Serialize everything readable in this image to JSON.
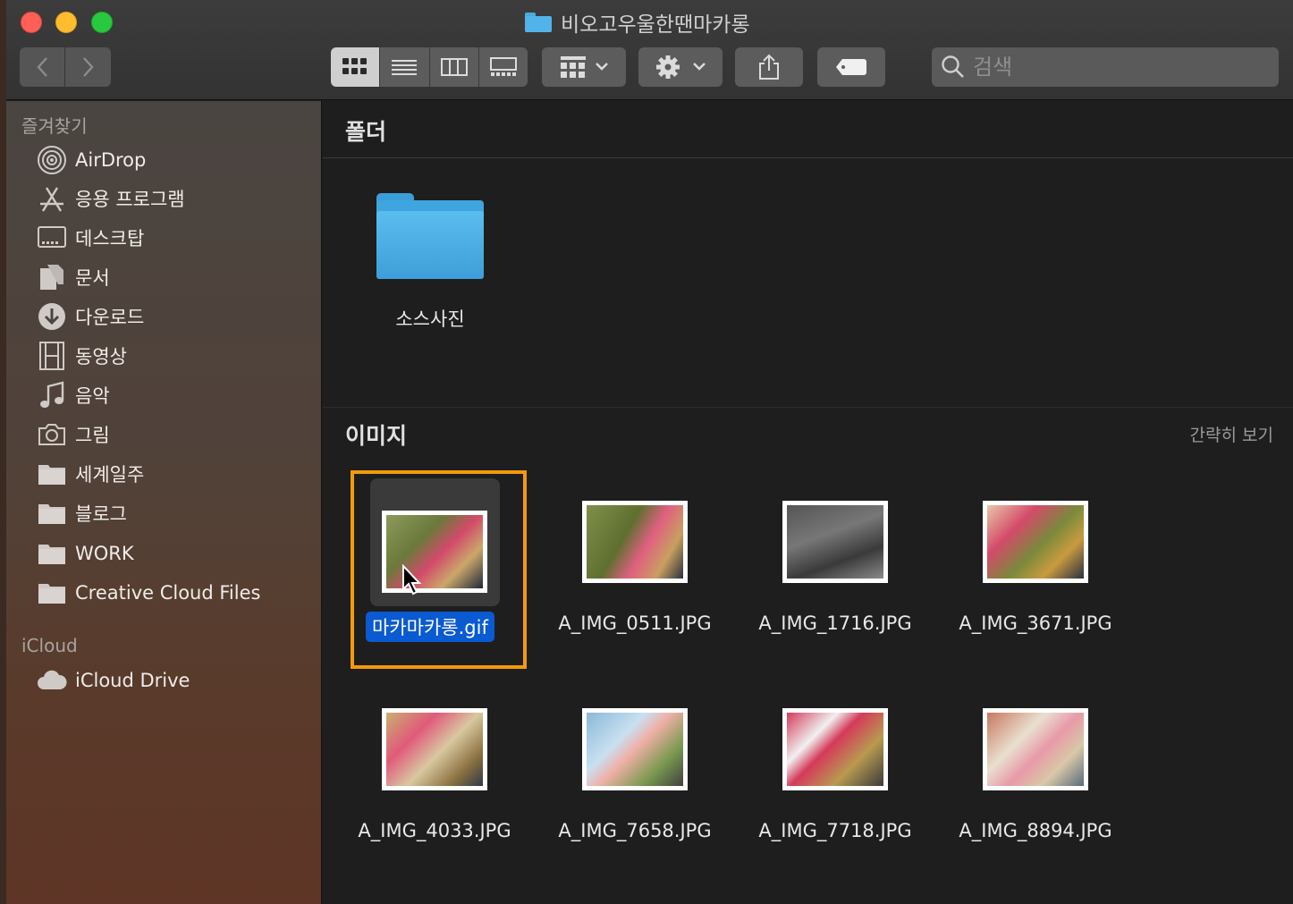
{
  "window": {
    "title": "비오고우울한땐마카롱"
  },
  "search": {
    "placeholder": "검색"
  },
  "sidebar": {
    "favorites_heading": "즐겨찾기",
    "items": [
      {
        "label": "AirDrop",
        "icon": "airdrop-icon"
      },
      {
        "label": "응용 프로그램",
        "icon": "applications-icon"
      },
      {
        "label": "데스크탑",
        "icon": "desktop-icon"
      },
      {
        "label": "문서",
        "icon": "documents-icon"
      },
      {
        "label": "다운로드",
        "icon": "downloads-icon"
      },
      {
        "label": "동영상",
        "icon": "movies-icon"
      },
      {
        "label": "음악",
        "icon": "music-icon"
      },
      {
        "label": "그림",
        "icon": "pictures-icon"
      },
      {
        "label": "세계일주",
        "icon": "folder-icon"
      },
      {
        "label": "블로그",
        "icon": "folder-icon"
      },
      {
        "label": "WORK",
        "icon": "folder-icon"
      },
      {
        "label": "Creative Cloud Files",
        "icon": "folder-icon"
      }
    ],
    "icloud_heading": "iCloud",
    "icloud_items": [
      {
        "label": "iCloud Drive",
        "icon": "cloud-icon"
      }
    ]
  },
  "content": {
    "folders_heading": "폴더",
    "folders": [
      {
        "name": "소스사진"
      }
    ],
    "images_heading": "이미지",
    "view_toggle": "간략히 보기",
    "files": [
      {
        "name": "마카마카롱.gif",
        "selected": true
      },
      {
        "name": "A_IMG_0511.JPG"
      },
      {
        "name": "A_IMG_1716.JPG"
      },
      {
        "name": "A_IMG_3671.JPG"
      },
      {
        "name": "A_IMG_4033.JPG"
      },
      {
        "name": "A_IMG_7658.JPG"
      },
      {
        "name": "A_IMG_7718.JPG"
      },
      {
        "name": "A_IMG_8894.JPG"
      }
    ]
  },
  "colors": {
    "selection_outline": "#f29a0c",
    "selection_label": "#0a5ad1",
    "folder_blue": "#52b3ea"
  }
}
